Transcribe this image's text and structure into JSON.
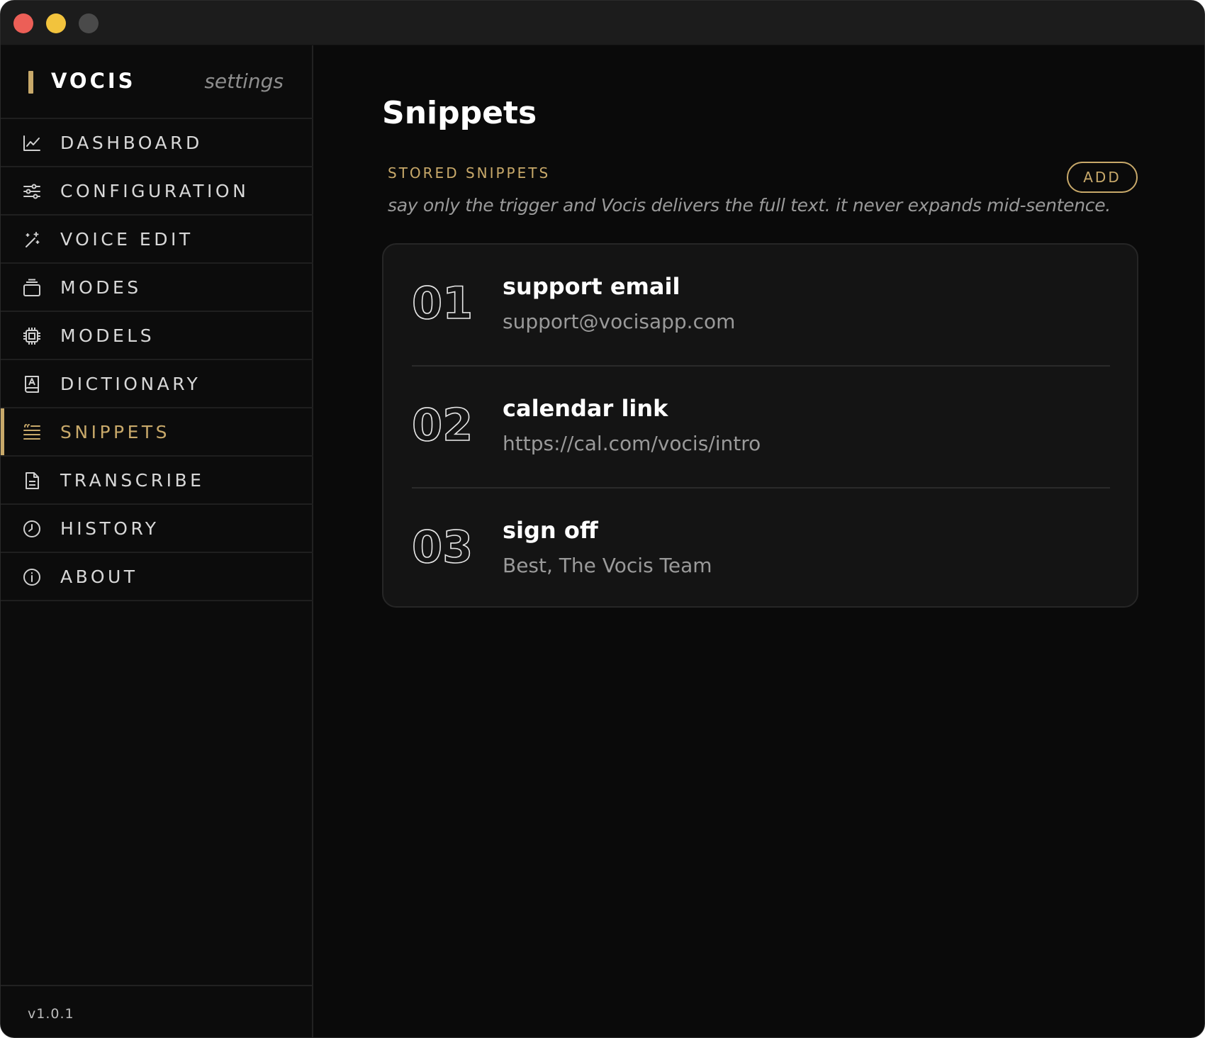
{
  "window": {
    "traffic_lights": [
      "close",
      "minimize",
      "zoom"
    ]
  },
  "sidebar": {
    "brand": "VOCIS",
    "subtitle": "settings",
    "accent": "#c8a96a",
    "items": [
      {
        "label": "DASHBOARD",
        "icon": "chart-line-icon",
        "active": false
      },
      {
        "label": "CONFIGURATION",
        "icon": "sliders-icon",
        "active": false
      },
      {
        "label": "VOICE EDIT",
        "icon": "magic-wand-icon",
        "active": false
      },
      {
        "label": "MODES",
        "icon": "stack-icon",
        "active": false
      },
      {
        "label": "MODELS",
        "icon": "chip-icon",
        "active": false
      },
      {
        "label": "DICTIONARY",
        "icon": "book-icon",
        "active": false
      },
      {
        "label": "SNIPPETS",
        "icon": "quote-list-icon",
        "active": true
      },
      {
        "label": "TRANSCRIBE",
        "icon": "document-icon",
        "active": false
      },
      {
        "label": "HISTORY",
        "icon": "clock-icon",
        "active": false
      },
      {
        "label": "ABOUT",
        "icon": "info-icon",
        "active": false
      }
    ],
    "version": "v1.0.1"
  },
  "main": {
    "title": "Snippets",
    "section_label": "STORED SNIPPETS",
    "add_label": "ADD",
    "description": "say only the trigger and Vocis delivers the full text. it never expands mid-sentence.",
    "snippets": [
      {
        "number": "01",
        "trigger": "support email",
        "expansion": "support@vocisapp.com"
      },
      {
        "number": "02",
        "trigger": "calendar link",
        "expansion": "https://cal.com/vocis/intro"
      },
      {
        "number": "03",
        "trigger": "sign off",
        "expansion": "Best, The Vocis Team"
      }
    ]
  }
}
